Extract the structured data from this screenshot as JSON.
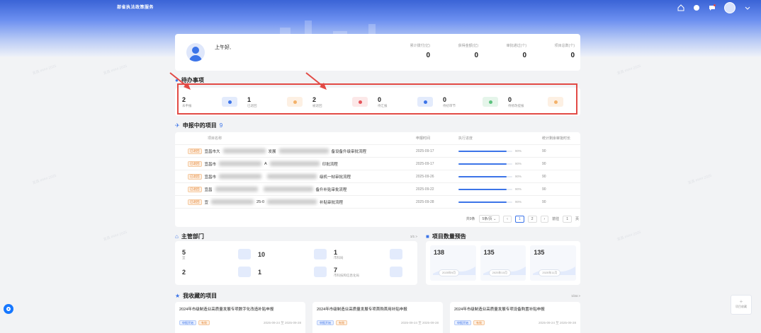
{
  "app": {
    "title": "部省执法政策服务"
  },
  "header": {
    "icons": [
      "home-icon",
      "notification-icon",
      "message-icon",
      "user-avatar",
      "chevron-down-icon"
    ]
  },
  "welcome": {
    "greeting": "上午好,",
    "stats": [
      {
        "label": "累计拨付(亿)",
        "value": "0"
      },
      {
        "label": "获得金额(亿)",
        "value": "0"
      },
      {
        "label": "审批通过(个)",
        "value": "0"
      },
      {
        "label": "项目总数(个)",
        "value": "0"
      }
    ]
  },
  "todo": {
    "title": "待办事项",
    "items": [
      {
        "count": "2",
        "label": "未申报",
        "bg": "#e3ebfc",
        "dot": "#3c74e8"
      },
      {
        "count": "1",
        "label": "已退回",
        "bg": "#fdf0e3",
        "dot": "#f3b26a"
      },
      {
        "count": "2",
        "label": "被退回",
        "bg": "#fce8e8",
        "dot": "#e5545a"
      },
      {
        "count": "0",
        "label": "待汇报",
        "bg": "#e3ebfc",
        "dot": "#3c74e8"
      },
      {
        "count": "0",
        "label": "待初审节",
        "bg": "#e5f5ea",
        "dot": "#5cc27e"
      },
      {
        "count": "0",
        "label": "待修改提报",
        "bg": "#fdf0e3",
        "dot": "#f3b26a"
      }
    ]
  },
  "projects": {
    "title": "申报中的项目",
    "count": "9",
    "columns": [
      "项目名称",
      "申报时间",
      "执行进度",
      "统计剩余审批时长"
    ],
    "rows": [
      {
        "tag": "已退回",
        "name_start": "宜昌市大",
        "name_mid": "发展",
        "name_end": "备设备升级审批流程",
        "date": "2025-09-17",
        "progress": 0.9,
        "pct": "90%",
        "remain": "90"
      },
      {
        "tag": "已退回",
        "name_start": "宜昌市",
        "name_mid": "A",
        "name_end": "印批流程",
        "date": "2025-09-17",
        "progress": 0.9,
        "pct": "90%",
        "remain": "90"
      },
      {
        "tag": "已退回",
        "name_start": "宜昌市",
        "name_mid": "",
        "name_end": "级机一帖审批流程",
        "date": "2025-09-26",
        "progress": 0.9,
        "pct": "90%",
        "remain": "90"
      },
      {
        "tag": "已退回",
        "name_start": "宜昌",
        "name_mid": "",
        "name_end": "备升补贴审批流程",
        "date": "2025-09-22",
        "progress": 0.9,
        "pct": "90%",
        "remain": "90"
      },
      {
        "tag": "已退回",
        "name_start": "宜",
        "name_mid": "25-0",
        "name_end": "补贴审批流程",
        "date": "2025-09-28",
        "progress": 0.9,
        "pct": "90%",
        "remain": "90"
      }
    ],
    "pager": {
      "total": "共9条",
      "size": "5条/页",
      "pages": [
        "1",
        "2"
      ],
      "current": "1",
      "goto": "前往",
      "goto_page": "1",
      "unit": "页"
    }
  },
  "departments": {
    "title": "主管部门",
    "pager": "1/1 >",
    "items": [
      {
        "count": "5",
        "name": "宜"
      },
      {
        "count": "10",
        "name": ""
      },
      {
        "count": "1",
        "name": "市科局"
      },
      {
        "count": "2",
        "name": ""
      },
      {
        "count": "1",
        "name": ""
      },
      {
        "count": "7",
        "name": "市科技和信息化局"
      }
    ]
  },
  "forecast": {
    "title": "项目数量预告",
    "items": [
      {
        "count": "138",
        "label": "2025年9月"
      },
      {
        "count": "135",
        "label": "2025年10月"
      },
      {
        "count": "135",
        "label": "2025年11月"
      }
    ]
  },
  "favorites": {
    "title": "我收藏的项目",
    "pager": "1/34 >",
    "items": [
      {
        "title": "2024年市级制造业高质量发展专项数字化改造补贴申报",
        "tag1": "申报开始",
        "tag2": "有效",
        "date": "2025-09-24 至 2025-09-28"
      },
      {
        "title": "2024年市级制造业高质量发展专项首购首用补贴申报",
        "tag1": "申报开始",
        "tag2": "有效",
        "date": "2025-09-24 至 2025-09-28"
      },
      {
        "title": "2024年市级制造业高质量发展专项设备购置补贴申报",
        "tag1": "申报开始",
        "tag2": "有效",
        "date": "2025-09-24 至 2025-09-28"
      }
    ]
  },
  "float_right": {
    "label": "项目收藏"
  },
  "colors": {
    "primary": "#3c74e8",
    "highlight": "#e24a45",
    "warning": "#e6893c"
  }
}
